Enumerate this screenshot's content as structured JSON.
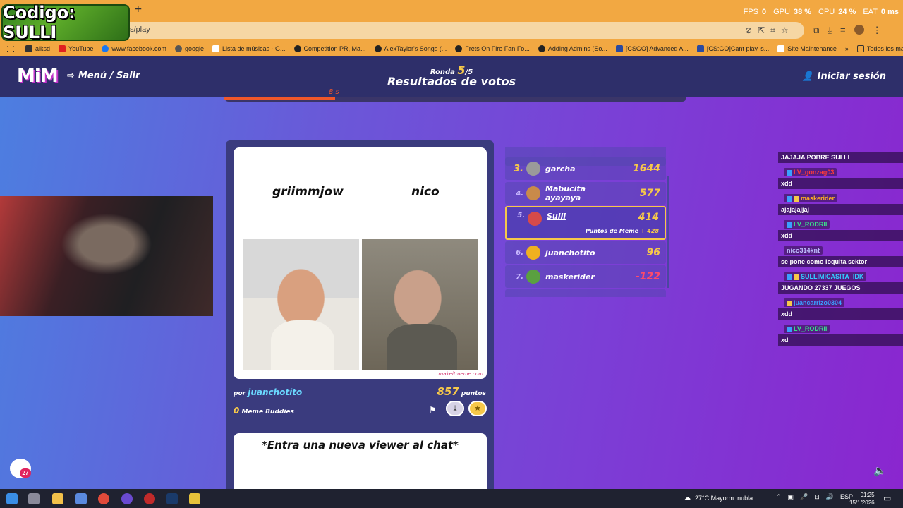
{
  "stream_overlay": {
    "code_text": "Codigo: SULLI"
  },
  "browser": {
    "new_tab_symbol": "+",
    "perf": [
      {
        "label": "FPS",
        "value": "0"
      },
      {
        "label": "GPU",
        "value": "38 %"
      },
      {
        "label": "CPU",
        "value": "24 %"
      },
      {
        "label": "EAT",
        "value": "0 ms"
      }
    ],
    "url_fragment": "s/play",
    "bookmarks": [
      "alksd",
      "YouTube",
      "www.facebook.com",
      "google",
      "Lista de músicas - G...",
      "Competition PR, Ma...",
      "AlexTaylor's Songs (...",
      "Frets On Fire Fan Fo...",
      "Adding Admins (So...",
      "[CSGO] Advanced A...",
      "[CS:GO]Cant play, s...",
      "Site Maintenance"
    ],
    "bookmarks_more": "»",
    "bookmarks_folder": "Todos los marcadores"
  },
  "site": {
    "logo": "MiM",
    "menu_label": "Menú / Salir",
    "round_label": "Ronda",
    "round_current": "5",
    "round_total": "/5",
    "page_title": "Resultados de votos",
    "timer_text": "8 s",
    "timer_progress": 0.24,
    "login_label": "Iniciar sesión"
  },
  "meme": {
    "caption_left": "griimmjow",
    "caption_right": "nico",
    "watermark": "makeitmeme.com",
    "by_label": "por",
    "author": "juanchotito",
    "points_value": "857",
    "points_label": "puntos",
    "buddies_count": "0",
    "buddies_label": "Meme Buddies",
    "next_caption": "*Entra una nueva viewer al chat*"
  },
  "ranking": [
    {
      "pos": "3.",
      "name": "garcha",
      "score": "1644",
      "color": "#f6c84a"
    },
    {
      "pos": "4.",
      "name": "Mabucita ayayaya",
      "score": "577",
      "color": "#f6c84a"
    },
    {
      "pos": "5.",
      "name": "Sulli",
      "score": "414",
      "extra_label": "Puntos de Meme",
      "extra_value": "+ 428",
      "highlight": true
    },
    {
      "pos": "6.",
      "name": "juanchotito",
      "score": "96",
      "color": "#f6c84a"
    },
    {
      "pos": "7.",
      "name": "maskerider",
      "score": "-122",
      "color": "#ff4a6a"
    }
  ],
  "chat": [
    {
      "user": "",
      "text": "JAJAJA POBRE SULLI"
    },
    {
      "user": "LV_gonzag03",
      "color": "#ff3a3a",
      "text": "xdd"
    },
    {
      "user": "maskerider",
      "color": "#ffb020",
      "text": "ajajajajjaj"
    },
    {
      "user": "LV_RODRII",
      "color": "#39e08a",
      "text": "xdd"
    },
    {
      "user": "nico314knt",
      "color": "#c0c0ff",
      "text": "se pone como loquita sektor"
    },
    {
      "user": "SULLIMICASITA_IDK",
      "color": "#33ccff",
      "text": "JUGANDO 27337 JUEGOS"
    },
    {
      "user": "juancarrizo0304",
      "color": "#3aa0ff",
      "text": "xdd"
    },
    {
      "user": "LV_RODRII",
      "color": "#39e08a",
      "text": "xd"
    }
  ],
  "notif_badge": "27",
  "taskbar": {
    "weather": "27°C  Mayorm. nubla...",
    "lang": "ESP",
    "time": "01:25",
    "date": "15/1/2026"
  }
}
